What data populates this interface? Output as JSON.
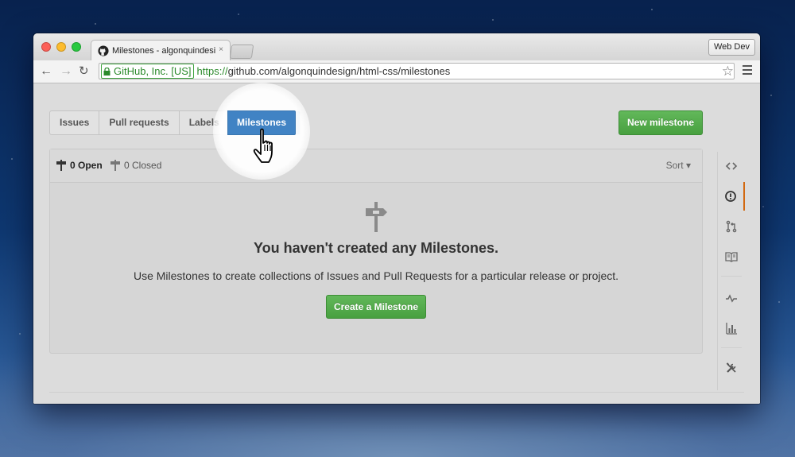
{
  "browser": {
    "tab_title": "Milestones - algonquindesign/html-css",
    "tab_close": "×",
    "profile_label": "Web Dev",
    "ev_label": "GitHub, Inc. [US]",
    "url_scheme": "https://",
    "url_rest": "github.com/algonquindesign/html-css/milestones",
    "star": "☆",
    "back": "←",
    "forward": "→",
    "reload": "↻"
  },
  "subnav": {
    "items": [
      {
        "label": "Issues"
      },
      {
        "label": "Pull requests"
      },
      {
        "label": "Labels"
      },
      {
        "label": "Milestones"
      }
    ],
    "selected_index": 3
  },
  "new_milestone_label": "New milestone",
  "list": {
    "open_label": "0 Open",
    "closed_label": "0 Closed",
    "sort_label": "Sort ▾"
  },
  "blank": {
    "title": "You haven't created any Milestones.",
    "description": "Use Milestones to create collections of Issues and Pull Requests for a particular release or project.",
    "button": "Create a Milestone"
  },
  "reponav": {
    "items": [
      "code-icon",
      "issues-icon",
      "pull-request-icon",
      "wiki-icon",
      "pulse-icon",
      "graphs-icon",
      "settings-icon"
    ],
    "selected": "issues-icon"
  },
  "colors": {
    "accent_blue": "#4183c4",
    "button_green": "#55aa4d",
    "selected_marker": "#d26911"
  }
}
